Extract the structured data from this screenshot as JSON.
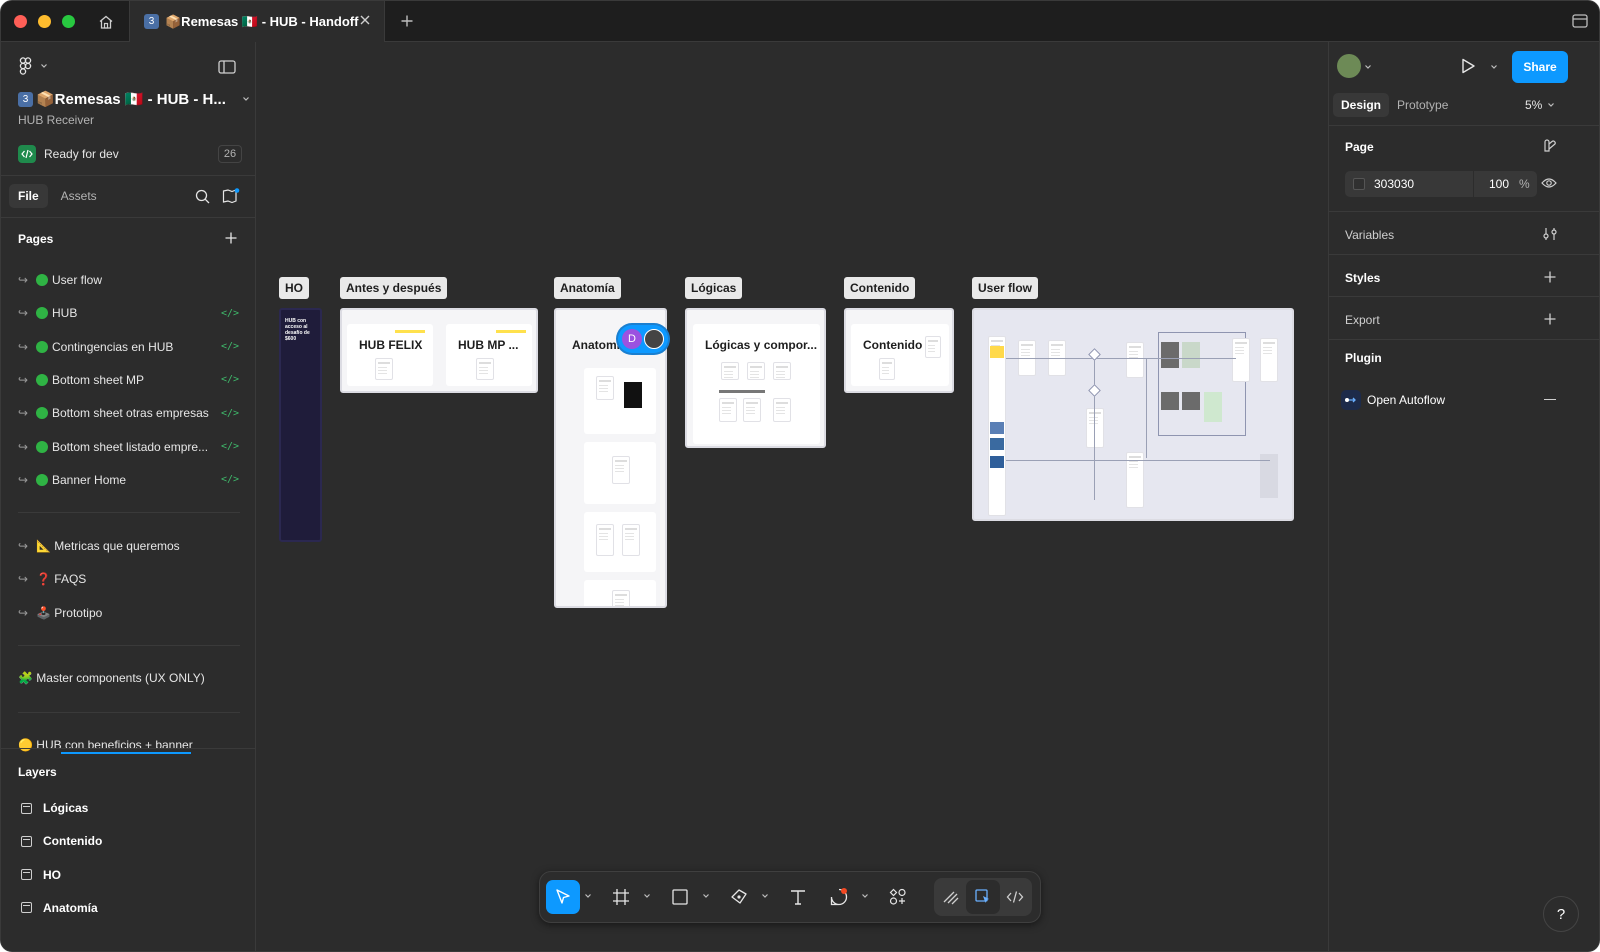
{
  "tab": {
    "badge": "3",
    "title": "📦Remesas 🇲🇽 - HUB - Handoff"
  },
  "file": {
    "badge": "3",
    "name": "📦Remesas 🇲🇽 - HUB - H...",
    "subtitle": "HUB Receiver",
    "ready_label": "Ready for dev",
    "ready_count": "26"
  },
  "left_tabs": {
    "file": "File",
    "assets": "Assets"
  },
  "pages": {
    "title": "Pages",
    "items": [
      {
        "label": "User flow",
        "dot": true,
        "dev": false
      },
      {
        "label": "HUB",
        "dot": true,
        "dev": true
      },
      {
        "label": "Contingencias en HUB",
        "dot": true,
        "dev": true
      },
      {
        "label": "Bottom sheet MP",
        "dot": true,
        "dev": true
      },
      {
        "label": "Bottom sheet otras empresas",
        "dot": true,
        "dev": true
      },
      {
        "label": "Bottom sheet listado empre...",
        "dot": true,
        "dev": true
      },
      {
        "label": "Banner Home",
        "dot": true,
        "dev": true
      }
    ],
    "extra": [
      {
        "label": "📐 Metricas que queremos"
      },
      {
        "label": "❓ FAQS"
      },
      {
        "label": "🕹️ Prototipo"
      }
    ],
    "master": "🧩 Master components (UX ONLY)",
    "hub_banner": "🟡 HUB con beneficios + banner"
  },
  "layers": {
    "title": "Layers",
    "items": [
      "Lógicas",
      "Contenido",
      "HO",
      "Anatomía"
    ]
  },
  "canvas": {
    "frames": [
      {
        "label": "HO",
        "inner": ""
      },
      {
        "label": "Antes y después",
        "cards": [
          "HUB FELIX",
          "HUB MP ..."
        ]
      },
      {
        "label": "Anatomía",
        "inner": "Anatomí"
      },
      {
        "label": "Lógicas",
        "inner": "Lógicas y compor..."
      },
      {
        "label": "Contenido",
        "inner": "Contenido"
      },
      {
        "label": "User flow",
        "inner": ""
      }
    ],
    "ho_text": "HUB con acceso al desafío de $600",
    "cursor_initial": "D"
  },
  "right": {
    "share": "Share",
    "design_tab": "Design",
    "prototype_tab": "Prototype",
    "zoom": "5%",
    "page_title": "Page",
    "page_color": "303030",
    "page_opacity": "100",
    "percent": "%",
    "variables": "Variables",
    "styles": "Styles",
    "export": "Export",
    "plugin": "Plugin",
    "plugin_item": "Open Autoflow"
  },
  "help": "?",
  "colors": {
    "accent": "#0d99ff",
    "green": "#2fb344",
    "bg": "#2c2c2c"
  }
}
